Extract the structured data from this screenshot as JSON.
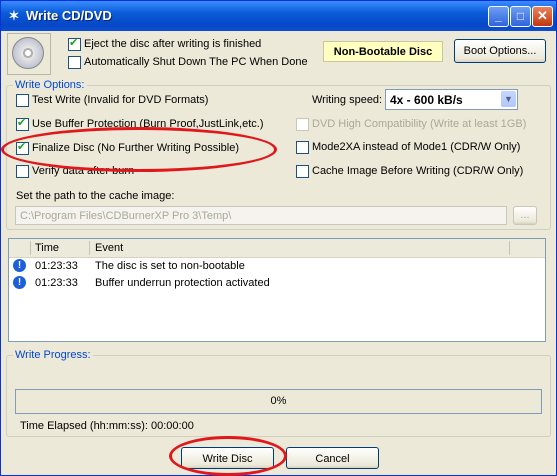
{
  "window": {
    "title": "Write CD/DVD"
  },
  "top": {
    "eject_label": "Eject the disc after writing is finished",
    "eject_checked": true,
    "shutdown_label": "Automatically Shut Down The PC When Done",
    "shutdown_checked": false,
    "bootable_status": "Non-Bootable Disc",
    "boot_options_label": "Boot Options..."
  },
  "write_options": {
    "group_label": "Write Options:",
    "test_write": "Test Write (Invalid for DVD Formats)",
    "buffer_protection": "Use Buffer Protection (Burn Proof,JustLink,etc.)",
    "finalize": "Finalize Disc (No Further Writing Possible)",
    "verify": "Verify data after burn",
    "speed_label": "Writing speed:",
    "speed_value": "4x - 600 kB/s",
    "dvd_compat": "DVD High Compatibility (Write at least 1GB)",
    "mode2xa": "Mode2XA instead of Mode1 (CDR/W Only)",
    "cache_image": "Cache Image Before Writing (CDR/W Only)",
    "cache_path_label": "Set the path to the cache image:",
    "cache_path_value": "C:\\Program Files\\CDBurnerXP Pro 3\\Temp\\",
    "browse_label": "..."
  },
  "log": {
    "col_time": "Time",
    "col_event": "Event",
    "rows": [
      {
        "time": "01:23:33",
        "event": "The disc is set to non-bootable"
      },
      {
        "time": "01:23:33",
        "event": "Buffer underrun protection activated"
      }
    ]
  },
  "progress": {
    "group_label": "Write Progress:",
    "percent_text": "0%",
    "percent": 0,
    "elapsed": "Time Elapsed (hh:mm:ss): 00:00:00"
  },
  "buttons": {
    "write": "Write Disc",
    "cancel": "Cancel"
  },
  "colors": {
    "title_bar": "#0a5bd8",
    "annotation": "#e0181b",
    "group_label": "#0046d5"
  }
}
